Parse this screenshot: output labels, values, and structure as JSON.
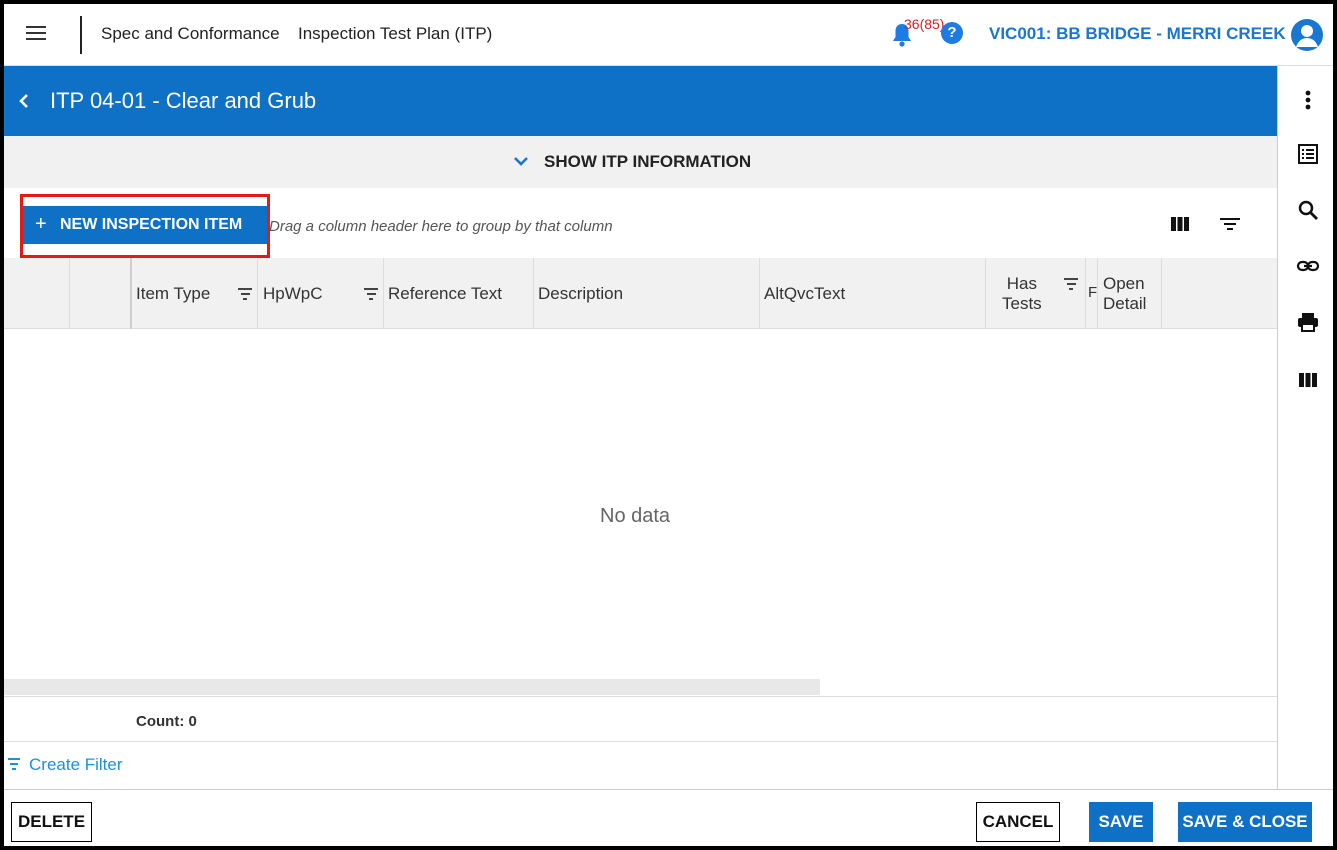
{
  "topbar": {
    "app_title": "Spec and Conformance",
    "page_title": "Inspection Test Plan (ITP)",
    "notification_count": "36(85)",
    "help_label": "?",
    "project_name": "VIC001: BB BRIDGE - MERRI CREEK"
  },
  "header": {
    "title": "ITP 04-01 - Clear and Grub"
  },
  "info_bar": {
    "label": "SHOW ITP INFORMATION"
  },
  "toolbar": {
    "new_item_plus": "+",
    "new_item_label": "NEW INSPECTION ITEM",
    "group_hint": "Drag a column header here to group by that column"
  },
  "grid": {
    "columns": [
      {
        "label": ""
      },
      {
        "label": ""
      },
      {
        "label": "Item Type"
      },
      {
        "label": "HpWpC"
      },
      {
        "label": "Reference Text"
      },
      {
        "label": "Description"
      },
      {
        "label": "AltQvcText"
      },
      {
        "label_line1": "Has",
        "label_line2": "Tests"
      },
      {
        "label": "F"
      },
      {
        "label_line1": "Open",
        "label_line2": "Detail"
      }
    ],
    "empty_text": "No data",
    "count_text": "Count: 0",
    "create_filter": "Create Filter"
  },
  "footer": {
    "delete": "DELETE",
    "cancel": "CANCEL",
    "save": "SAVE",
    "save_close": "SAVE & CLOSE"
  },
  "colors": {
    "primary": "#0f71c6",
    "highlight_outline": "#e01b1b",
    "notification": "#d41f1f",
    "link": "#1e90d8"
  }
}
